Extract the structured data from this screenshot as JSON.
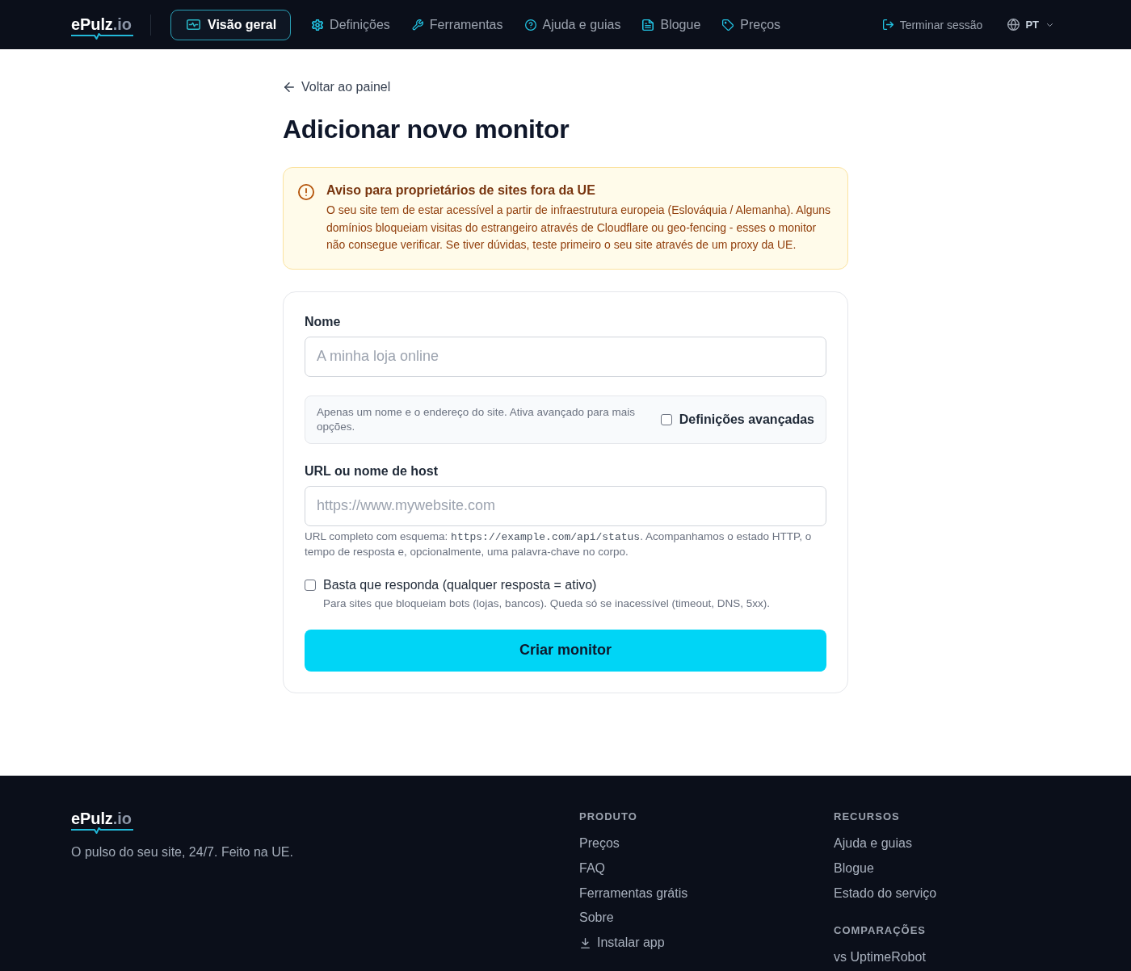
{
  "nav": {
    "logo": {
      "name": "ePulz",
      "suffix": ".io"
    },
    "items": [
      {
        "label": "Visão geral",
        "selected": true
      },
      {
        "label": "Definições",
        "selected": false
      },
      {
        "label": "Ferramentas",
        "selected": false
      },
      {
        "label": "Ajuda e guias",
        "selected": false
      },
      {
        "label": "Blogue",
        "selected": false
      },
      {
        "label": "Preços",
        "selected": false
      }
    ],
    "logout": "Terminar sessão",
    "language": "PT"
  },
  "back_link": "Voltar ao painel",
  "title": "Adicionar novo monitor",
  "notice": {
    "title": "Aviso para proprietários de sites fora da UE",
    "text": "O seu site tem de estar acessível a partir de infraestrutura europeia (Eslováquia / Alemanha). Alguns domínios bloqueiam visitas do estrangeiro através de Cloudflare ou geo-fencing - esses o monitor não consegue verificar. Se tiver dúvidas, teste primeiro o seu site através de um proxy da UE."
  },
  "form": {
    "name_field": {
      "label": "Nome",
      "placeholder": "A minha loja online"
    },
    "mode_panel": {
      "text": "Apenas um nome e o endereço do site. Ativa avançado para mais opções.",
      "advanced": {
        "label": "Definições avançadas",
        "checked": false
      }
    },
    "url_field": {
      "label": "URL ou nome de host",
      "placeholder": "https://www.mywebsite.com",
      "help": [
        {
          "kind": "text",
          "text": "URL completo com esquema: "
        },
        {
          "kind": "code",
          "text": "https://example.com/api/status"
        },
        {
          "kind": "text",
          "text": ". Acompanhamos o estado HTTP, o tempo de resposta e, opcionalmente, uma palavra-chave no corpo."
        }
      ]
    },
    "any_response": {
      "label": "Basta que responda (qualquer resposta = ativo)",
      "checked": false,
      "hint": "Para sites que bloqueiam bots (lojas, bancos). Queda só se inacessível (timeout, DNS, 5xx)."
    },
    "submit": "Criar monitor"
  },
  "footer": {
    "logo": {
      "name": "ePulz",
      "suffix": ".io"
    },
    "tagline": "O pulso do seu site, 24/7. Feito na UE.",
    "columns": [
      {
        "sections": [
          {
            "heading": "PRODUTO",
            "links": [
              {
                "label": "Preços",
                "kind": "link"
              },
              {
                "label": "FAQ",
                "kind": "link"
              },
              {
                "label": "Ferramentas grátis",
                "kind": "link"
              },
              {
                "label": "Sobre",
                "kind": "link"
              },
              {
                "label": "Instalar app",
                "kind": "download"
              }
            ]
          }
        ]
      },
      {
        "sections": [
          {
            "heading": "RECURSOS",
            "links": [
              {
                "label": "Ajuda e guias",
                "kind": "link"
              },
              {
                "label": "Blogue",
                "kind": "link"
              },
              {
                "label": "Estado do serviço",
                "kind": "link"
              }
            ]
          },
          {
            "heading": "COMPARAÇÕES",
            "links": [
              {
                "label": "vs UptimeRobot",
                "kind": "link"
              }
            ]
          }
        ]
      }
    ]
  }
}
